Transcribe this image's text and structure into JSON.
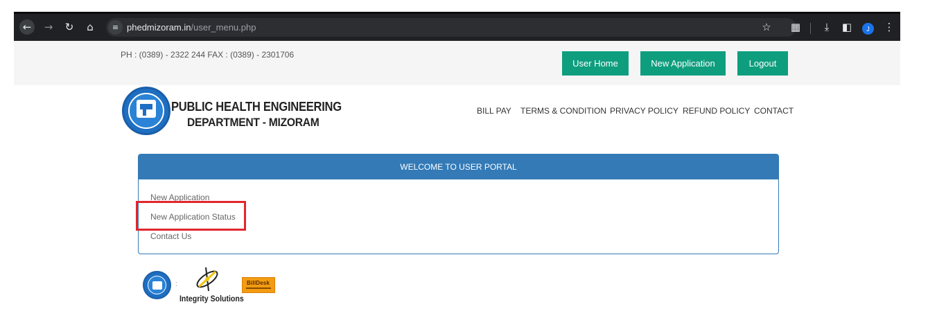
{
  "browser": {
    "url_host": "phedmizoram.in",
    "url_path": "/user_menu.php",
    "profile_initial": "J",
    "icons": {
      "back": "arrow-left-icon",
      "forward": "arrow-right-icon",
      "reload": "reload-icon",
      "home": "home-icon",
      "site_info": "tune-icon",
      "bookmark": "star-icon",
      "extensions": "puzzle-icon",
      "downloads": "download-icon",
      "side_panel": "side-panel-icon",
      "menu": "kebab-menu-icon"
    }
  },
  "topbar": {
    "contact_line": "PH : (0389) - 2322 244   FAX : (0389) - 2301706",
    "buttons": {
      "user_home": "User Home",
      "new_application": "New Application",
      "logout": "Logout"
    }
  },
  "header": {
    "dept_line1": "PUBLIC HEALTH ENGINEERING",
    "dept_line2": "DEPARTMENT  - MIZORAM",
    "nav": {
      "bill_pay": "BILL PAY",
      "terms": "TERMS & CONDITION",
      "privacy": "PRIVACY POLICY",
      "refund": "REFUND POLICY",
      "contact": "CONTACT"
    }
  },
  "panel": {
    "heading": "WELCOME TO USER PORTAL",
    "links": [
      "New Application",
      "New Application Status",
      "Contact Us"
    ]
  },
  "footer": {
    "separator": ":",
    "integrity_text": "Integrity Solutions",
    "billdesk_text": "BillDesk"
  },
  "colors": {
    "accent_green": "#0e9e7e",
    "panel_blue": "#337ab7",
    "highlight_red": "#e3262d"
  }
}
